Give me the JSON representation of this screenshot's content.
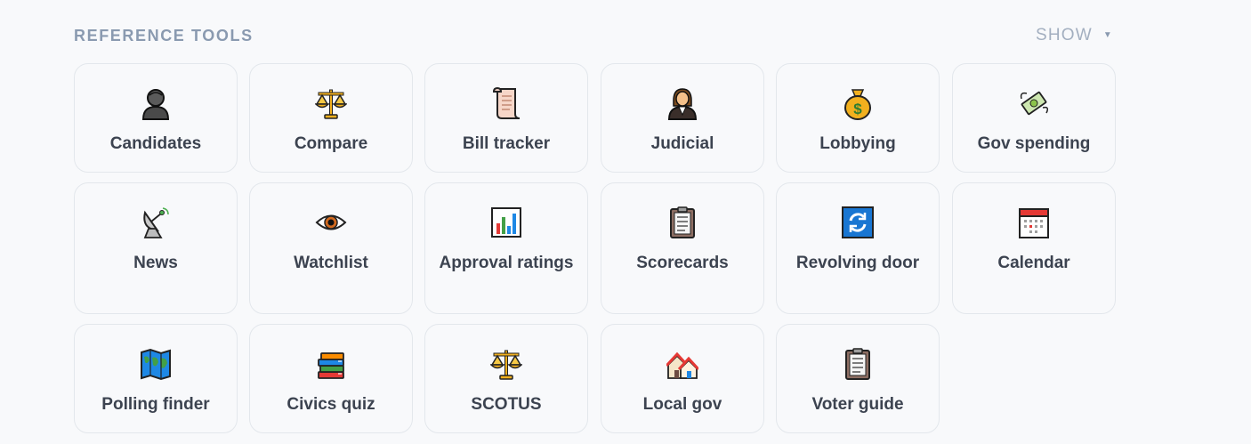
{
  "header": {
    "title": "REFERENCE TOOLS",
    "toggle_label": "SHOW",
    "toggle_icon": "caret-down"
  },
  "tools": [
    {
      "label": "Candidates",
      "icon": "person-bust-icon"
    },
    {
      "label": "Compare",
      "icon": "balance-scale-icon"
    },
    {
      "label": "Bill tracker",
      "icon": "scroll-icon"
    },
    {
      "label": "Judicial",
      "icon": "judge-icon"
    },
    {
      "label": "Lobbying",
      "icon": "money-bag-icon"
    },
    {
      "label": "Gov spending",
      "icon": "money-with-wings-icon"
    },
    {
      "label": "News",
      "icon": "satellite-antenna-icon"
    },
    {
      "label": "Watchlist",
      "icon": "eye-icon"
    },
    {
      "label": "Approval ratings",
      "icon": "bar-chart-icon"
    },
    {
      "label": "Scorecards",
      "icon": "clipboard-icon"
    },
    {
      "label": "Revolving door",
      "icon": "arrows-cycle-icon"
    },
    {
      "label": "Calendar",
      "icon": "calendar-icon"
    },
    {
      "label": "Polling finder",
      "icon": "world-map-icon"
    },
    {
      "label": "Civics quiz",
      "icon": "books-icon"
    },
    {
      "label": "SCOTUS",
      "icon": "balance-scale-icon"
    },
    {
      "label": "Local gov",
      "icon": "houses-icon"
    },
    {
      "label": "Voter guide",
      "icon": "clipboard-icon"
    }
  ]
}
